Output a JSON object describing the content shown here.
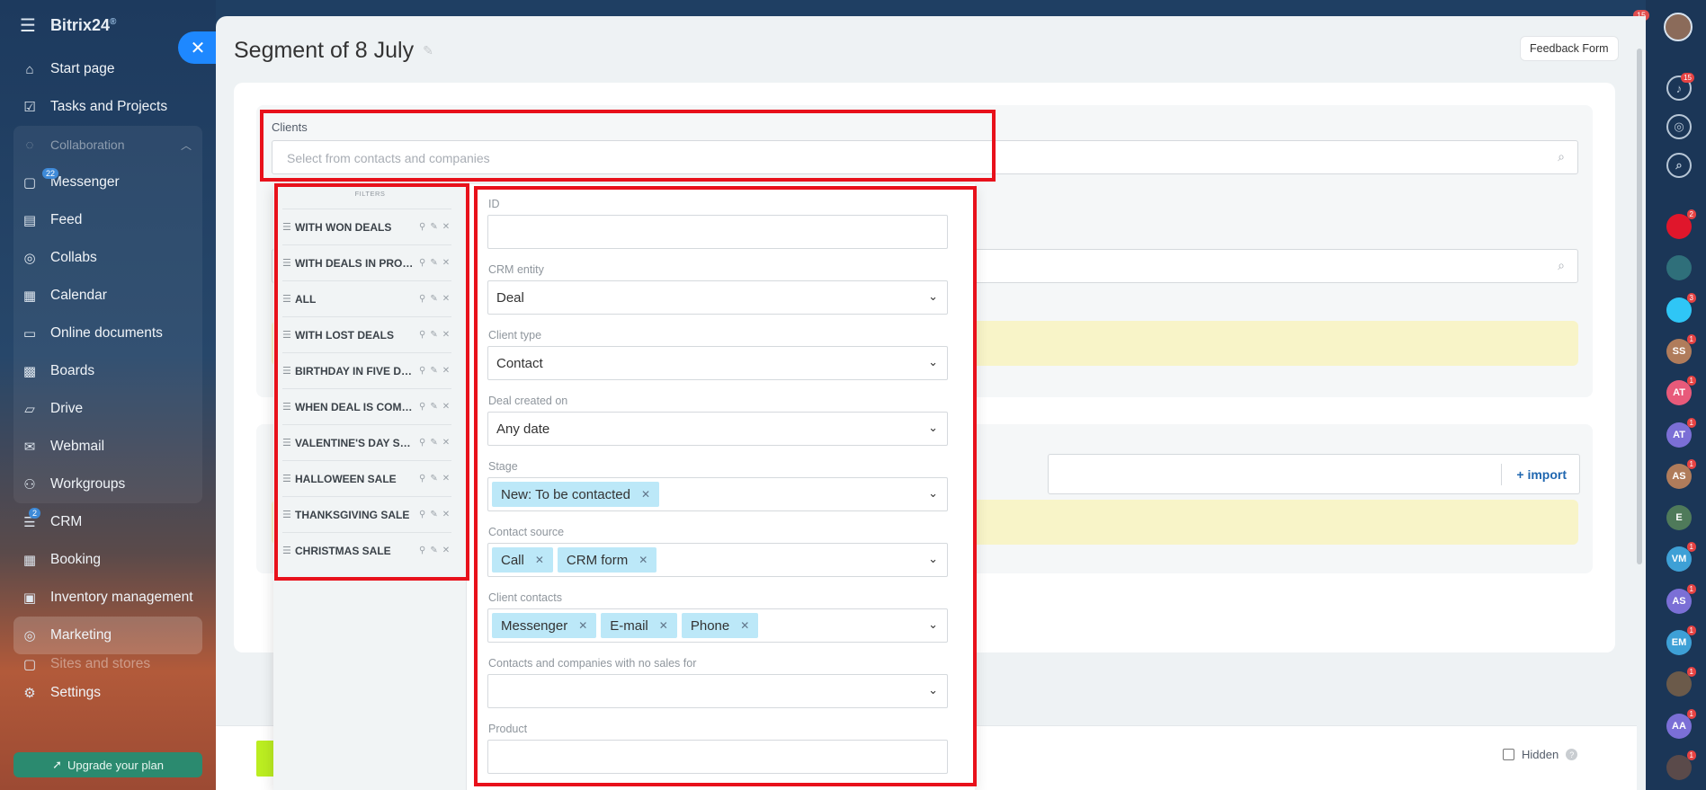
{
  "app": {
    "brand": "Bitrix24",
    "brand_mark": "®",
    "upgrade_label": "Upgrade your plan"
  },
  "sidebar": {
    "items": [
      {
        "label": "Start page",
        "icon": "home-icon"
      },
      {
        "label": "Tasks and Projects",
        "icon": "checkbox-icon"
      },
      {
        "label": "Collaboration",
        "icon": "chat-icon"
      },
      {
        "label": "Messenger",
        "icon": "message-icon",
        "badge": "22"
      },
      {
        "label": "Feed",
        "icon": "feed-icon"
      },
      {
        "label": "Collabs",
        "icon": "collabs-icon"
      },
      {
        "label": "Calendar",
        "icon": "calendar-icon"
      },
      {
        "label": "Online documents",
        "icon": "document-icon"
      },
      {
        "label": "Boards",
        "icon": "board-icon"
      },
      {
        "label": "Drive",
        "icon": "folder-icon"
      },
      {
        "label": "Webmail",
        "icon": "mail-icon"
      },
      {
        "label": "Workgroups",
        "icon": "users-icon"
      },
      {
        "label": "CRM",
        "icon": "crm-icon",
        "badge": "2"
      },
      {
        "label": "Booking",
        "icon": "booking-icon"
      },
      {
        "label": "Inventory management",
        "icon": "inventory-icon"
      },
      {
        "label": "Marketing",
        "icon": "target-icon"
      },
      {
        "label": "Sites and stores",
        "icon": "sites-icon"
      },
      {
        "label": "Settings",
        "icon": "gear-icon"
      }
    ]
  },
  "rail": {
    "top_badge": "15",
    "notif_badge": "15",
    "chats": [
      {
        "initials": "",
        "badge": "2",
        "color": "#e0162b"
      },
      {
        "initials": "",
        "badge": "",
        "color": "#2f6f7a"
      },
      {
        "initials": "",
        "badge": "3",
        "color": "#2fc6f6"
      },
      {
        "initials": "SS",
        "badge": "1",
        "color": "#b07c5b"
      },
      {
        "initials": "AT",
        "badge": "1",
        "color": "#e85a7a"
      },
      {
        "initials": "AT",
        "badge": "1",
        "color": "#7b6fd6"
      },
      {
        "initials": "AS",
        "badge": "1",
        "color": "#b07c5b"
      },
      {
        "initials": "E",
        "badge": "",
        "color": "#4f7a5a"
      },
      {
        "initials": "VM",
        "badge": "1",
        "color": "#3ea0d6"
      },
      {
        "initials": "AS",
        "badge": "1",
        "color": "#7b6fd6"
      },
      {
        "initials": "EM",
        "badge": "1",
        "color": "#3ea0d6"
      },
      {
        "initials": "",
        "badge": "1",
        "color": "#6b5a4a"
      },
      {
        "initials": "AA",
        "badge": "1",
        "color": "#7b6fd6"
      },
      {
        "initials": "",
        "badge": "1",
        "color": "#5a4a4a"
      }
    ]
  },
  "slider": {
    "title": "Segment of 8 July",
    "feedback_label": "Feedback Form",
    "clients_label": "Clients",
    "clients_placeholder": "Select from contacts and companies",
    "import_label": "+ import",
    "hidden_label": "Hidden",
    "help": "?"
  },
  "filter": {
    "presets_title": "FILTERS",
    "presets": [
      "WITH WON DEALS",
      "WITH DEALS IN PROGRESS",
      "ALL",
      "WITH LOST DEALS",
      "BIRTHDAY IN FIVE DAYS",
      "WHEN DEAL IS COMPLETED",
      "VALENTINE'S DAY SALE",
      "HALLOWEEN SALE",
      "THANKSGIVING SALE",
      "CHRISTMAS SALE"
    ],
    "fields": {
      "id": {
        "label": "ID",
        "value": ""
      },
      "crm_entity": {
        "label": "CRM entity",
        "value": "Deal"
      },
      "client_type": {
        "label": "Client type",
        "value": "Contact"
      },
      "deal_created_on": {
        "label": "Deal created on",
        "value": "Any date"
      },
      "stage": {
        "label": "Stage",
        "tags": [
          "New: To be contacted"
        ]
      },
      "contact_source": {
        "label": "Contact source",
        "tags": [
          "Call",
          "CRM form"
        ]
      },
      "client_contacts": {
        "label": "Client contacts",
        "tags": [
          "Messenger",
          "E-mail",
          "Phone"
        ]
      },
      "no_sales": {
        "label": "Contacts and companies with no sales for",
        "value": ""
      },
      "product": {
        "label": "Product",
        "value": ""
      }
    }
  }
}
